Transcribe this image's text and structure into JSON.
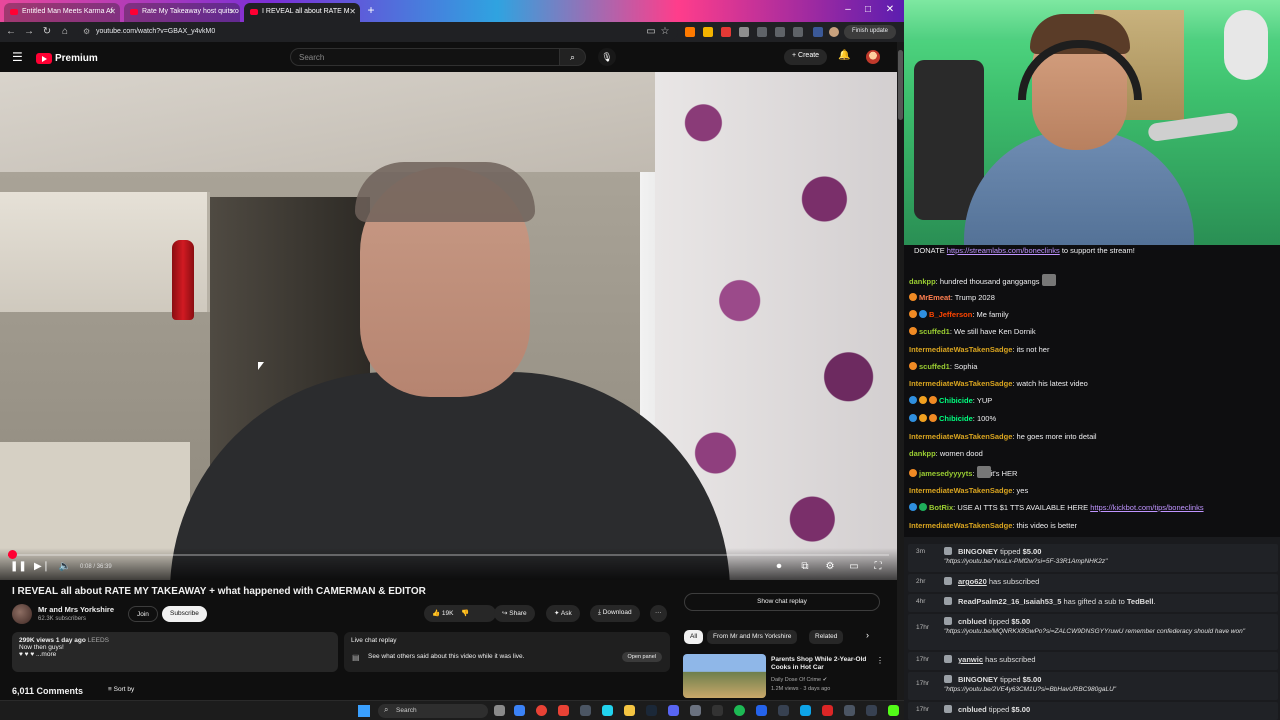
{
  "browser": {
    "tabs": [
      {
        "label": "Entitled Man Meets Karma Af"
      },
      {
        "label": "Rate My Takeaway host quits o"
      },
      {
        "label": "I REVEAL all about RATE M"
      }
    ],
    "url": "youtube.com/watch?v=GBAX_y4vkM0",
    "finish_update_label": "Finish update",
    "window_controls": {
      "minimize": "–",
      "maximize": "□",
      "close": "✕"
    }
  },
  "youtube": {
    "logo_text": "Premium",
    "search_placeholder": "Search",
    "create_label": "Create",
    "player": {
      "time": "0:08 / 36:39",
      "progress_fraction": 0.004
    },
    "video": {
      "title": "I REVEAL all about RATE MY TAKEAWAY + what happened with CAMERMAN & EDITOR",
      "channel": "Mr and Mrs Yorkshire",
      "subscribers": "62.3K subscribers",
      "join_label": "Join",
      "subscribe_label": "Subscribe",
      "likes": "19K",
      "share_label": "Share",
      "ask_label": "Ask",
      "download_label": "Download",
      "more_label": "···"
    },
    "description": {
      "views_date": "299K views  1 day ago",
      "location": "LEEDS",
      "line1": "Now then guys!",
      "line2": "♥ ♥ ♥  ...more"
    },
    "comments_count": "6,011 Comments",
    "sort_label": "Sort by",
    "live_chat_replay": {
      "title": "Live chat replay",
      "subtitle": "See what others said about this video while it was live.",
      "open_panel_label": "Open panel"
    },
    "show_chat_replay_label": "Show chat replay",
    "chips": [
      {
        "label": "All"
      },
      {
        "label": "From Mr and Mrs Yorkshire"
      },
      {
        "label": "Related"
      }
    ],
    "recommendation": {
      "title": "Parents Shop While 2-Year-Old Cooks in Hot Car",
      "channel": "Daily Dose Of Crime ✔",
      "meta": "1.2M views · 3 days ago"
    }
  },
  "taskbar": {
    "search_placeholder": "Search"
  },
  "chat": {
    "donate_text_pre": "DONATE ",
    "donate_link": "https://streamlabs.com/boneclinks",
    "donate_text_post": " to support the stream!",
    "messages": [
      {
        "user": "dankpp",
        "color": "#9acd32",
        "text": "hundred thousand ganggangs"
      },
      {
        "user": "MrEmeat",
        "color": "#ff7f50",
        "text": "Trump 2028"
      },
      {
        "user": "B_Jefferson",
        "color": "#ff4500",
        "text": "Me family"
      },
      {
        "user": "scuffed1",
        "color": "#9acd32",
        "text": "We still have Ken Dornik"
      },
      {
        "user": "IntermediateWasTakenSadge",
        "color": "#daa520",
        "text": "its not her"
      },
      {
        "user": "scuffed1",
        "color": "#9acd32",
        "text": "Sophia"
      },
      {
        "user": "IntermediateWasTakenSadge",
        "color": "#daa520",
        "text": "watch his latest video"
      },
      {
        "user": "Chibicide",
        "color": "#00ff7f",
        "text": "YUP"
      },
      {
        "user": "Chibicide",
        "color": "#00ff7f",
        "text": "100%"
      },
      {
        "user": "IntermediateWasTakenSadge",
        "color": "#daa520",
        "text": "he goes more into detail"
      },
      {
        "user": "dankpp",
        "color": "#9acd32",
        "text": "women dood"
      },
      {
        "user": "jamesedyyyyts",
        "color": "#9acd32",
        "text": "it's HER"
      },
      {
        "user": "IntermediateWasTakenSadge",
        "color": "#daa520",
        "text": "yes"
      },
      {
        "user": "BotRix",
        "color": "#9acd32",
        "text": "USE AI TTS $1 TTS AVAILABLE HERE ",
        "link": "https://kickbot.com/tips/boneclinks"
      },
      {
        "user": "IntermediateWasTakenSadge",
        "color": "#daa520",
        "text": "this video is better"
      }
    ]
  },
  "events": [
    {
      "time": "3m",
      "user": "BINGONEY",
      "action": " tipped ",
      "amount": "$5.00",
      "message": "\"https://youtu.be/YwsLx-PMf2w?si=5F-33R1AmpNHK2z\""
    },
    {
      "time": "2hr",
      "user": "argo620",
      "action": " has subscribed",
      "amount": "",
      "message": ""
    },
    {
      "time": "4hr",
      "user": "ReadPsalm22_16_Isaiah53_5",
      "action": " has gifted a sub to ",
      "amount": "TedBell",
      "message": ""
    },
    {
      "time": "17hr",
      "user": "cnblued",
      "action": " tipped ",
      "amount": "$5.00",
      "message": "\"https://youtu.be/MQNRKX8GwPo?si=ZALCW9DNSGYYruwU remember confederacy should have won\""
    },
    {
      "time": "17hr",
      "user": "yanwic",
      "action": " has subscribed",
      "amount": "",
      "message": ""
    },
    {
      "time": "17hr",
      "user": "BINGONEY",
      "action": " tipped ",
      "amount": "$5.00",
      "message": "\"https://youtu.be/2VE4y63CM1U?si=BbHavURBC980gaLU\""
    },
    {
      "time": "17hr",
      "user": "cnblued",
      "action": " tipped ",
      "amount": "$5.00",
      "message": ""
    }
  ]
}
